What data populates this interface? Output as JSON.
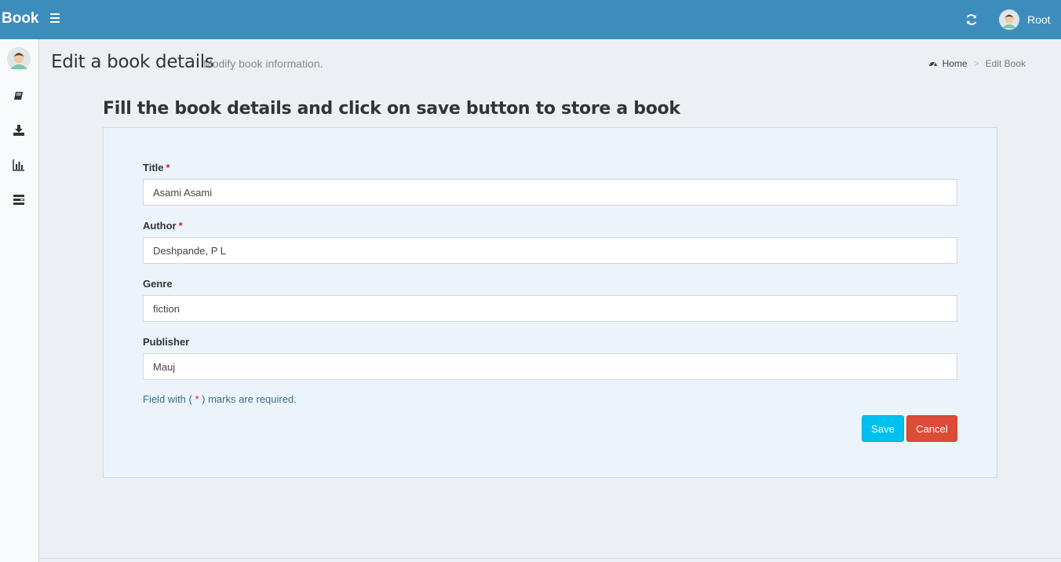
{
  "header": {
    "brand": "Book",
    "user_name": "Root"
  },
  "sidebar": {
    "items": [
      {
        "icon": "book-icon"
      },
      {
        "icon": "download-icon"
      },
      {
        "icon": "bar-chart-icon"
      },
      {
        "icon": "list-icon"
      }
    ]
  },
  "page": {
    "title": "Edit a book details",
    "subtitle": "Modify book information.",
    "breadcrumb": {
      "home": "Home",
      "separator": ">",
      "current": "Edit Book"
    }
  },
  "form": {
    "heading": "Fill the book details and click on save button to store a book",
    "fields": {
      "title": {
        "label": "Title",
        "required_mark": "*",
        "value": "Asami Asami"
      },
      "author": {
        "label": "Author",
        "required_mark": "*",
        "value": "Deshpande, P L"
      },
      "genre": {
        "label": "Genre",
        "value": "fiction"
      },
      "publisher": {
        "label": "Publisher",
        "value": "Mauj"
      }
    },
    "help": {
      "before": "Field with ( ",
      "star": "*",
      "after": " ) marks are required."
    },
    "save_label": "Save",
    "cancel_label": "Cancel"
  },
  "colors": {
    "header_bg": "#3c8dbc",
    "save": "#00c0ef",
    "cancel": "#dd4b39",
    "required": "#dd1c1c"
  }
}
